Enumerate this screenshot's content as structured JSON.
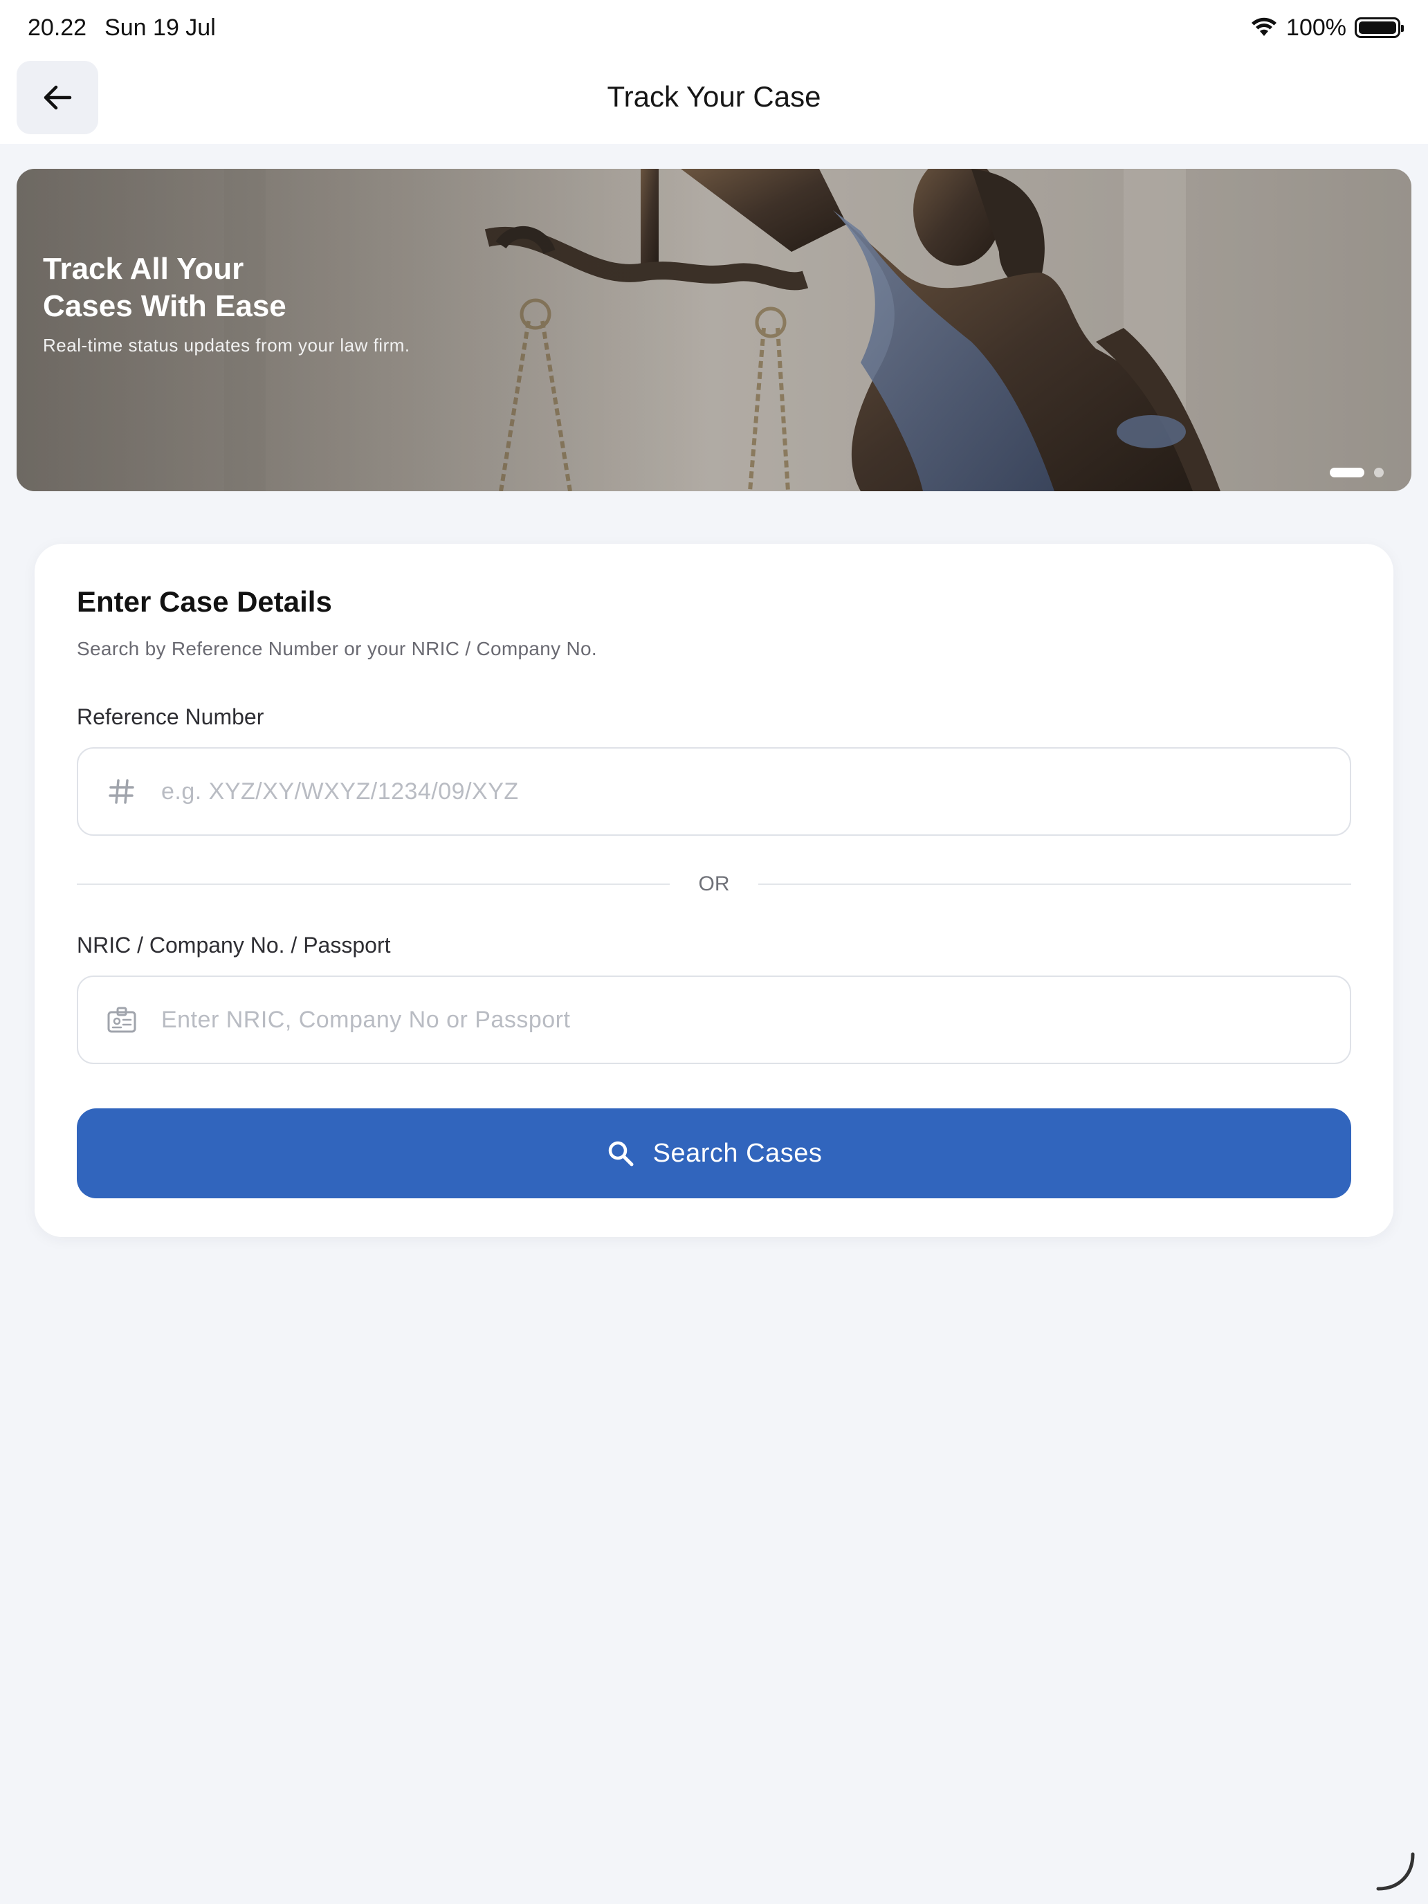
{
  "status_bar": {
    "time": "20.22",
    "date": "Sun 19 Jul",
    "battery": "100%"
  },
  "header": {
    "title": "Track Your Case",
    "back_icon": "arrow-left-icon"
  },
  "banner": {
    "title_line1": "Track All Your",
    "title_line2": "Cases With Ease",
    "subtitle": "Real-time status updates from your law firm.",
    "pages": 2,
    "active_page": 1
  },
  "form": {
    "title": "Enter Case Details",
    "subtitle": "Search by Reference Number or your NRIC / Company No.",
    "reference": {
      "label": "Reference Number",
      "placeholder": "e.g. XYZ/XY/WXYZ/1234/09/XYZ",
      "value": "",
      "icon": "hash-icon"
    },
    "divider": "OR",
    "nric": {
      "label": "NRIC / Company No. / Passport",
      "placeholder": "Enter NRIC, Company No or Passport",
      "value": "",
      "icon": "id-card-icon"
    },
    "search_button": {
      "label": "Search Cases",
      "icon": "search-icon"
    }
  },
  "colors": {
    "primary": "#3165bd",
    "background": "#f3f5f9",
    "card": "#ffffff"
  }
}
